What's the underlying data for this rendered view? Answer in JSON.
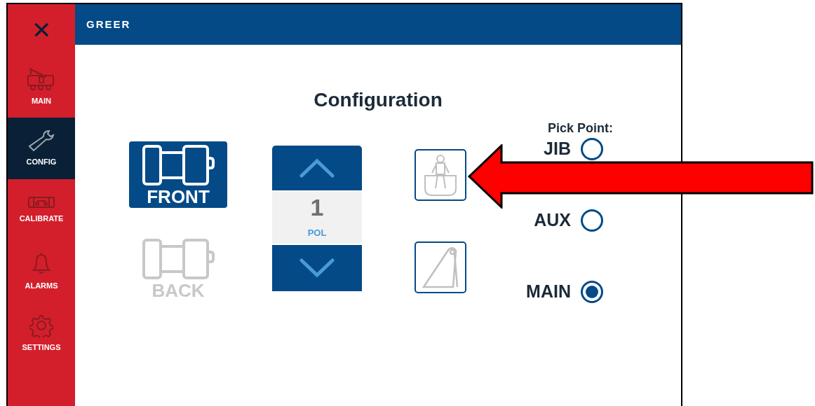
{
  "header": {
    "brand": "GREER"
  },
  "sidebar": {
    "close": "✕",
    "items": [
      {
        "label": "MAIN",
        "selected": false
      },
      {
        "label": "CONFIG",
        "selected": true
      },
      {
        "label": "CALIBRATE",
        "selected": false
      },
      {
        "label": "ALARMS",
        "selected": false
      },
      {
        "label": "SETTINGS",
        "selected": false
      }
    ]
  },
  "title": "Configuration",
  "sides": [
    {
      "label": "FRONT",
      "selected": true
    },
    {
      "label": "BACK",
      "selected": false
    }
  ],
  "stepper": {
    "value": "1",
    "unit": "POL"
  },
  "load_types": [
    {
      "kind": "basket"
    },
    {
      "kind": "jib"
    }
  ],
  "pick_point": {
    "label": "Pick Point:",
    "options": [
      {
        "label": "JIB",
        "selected": false
      },
      {
        "label": "AUX",
        "selected": false
      },
      {
        "label": "MAIN",
        "selected": true
      }
    ]
  }
}
